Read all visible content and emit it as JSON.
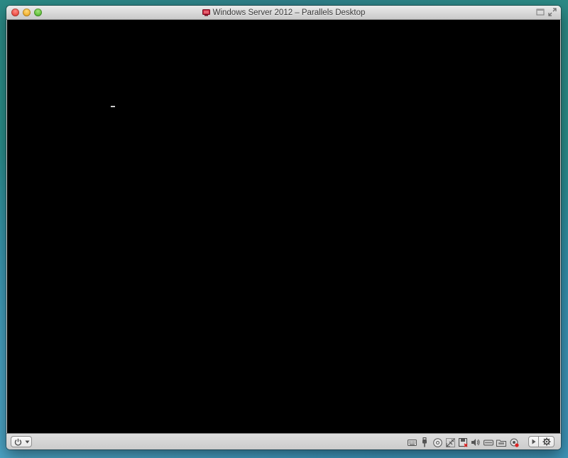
{
  "window": {
    "title": "Windows Server 2012 – Parallels Desktop"
  },
  "icons": {
    "title_vm_icon": "monitor-icon",
    "fullscreen": "fullscreen-icon",
    "coherence": "coherence-icon",
    "power": "power-icon",
    "power_menu": "chevron-down-icon",
    "devices": [
      "keyboard-icon",
      "usb-icon",
      "cd-dvd-icon",
      "network-icon",
      "floppy-icon",
      "sound-icon",
      "hard-disk-icon",
      "shared-folder-icon",
      "camera-icon"
    ],
    "play": "play-icon",
    "settings": "gear-icon"
  },
  "colors": {
    "screen": "#000000",
    "close": "#ec4f45",
    "minimize": "#f2b231",
    "zoom": "#5fc03a",
    "vm_icon": "#c2233c"
  }
}
